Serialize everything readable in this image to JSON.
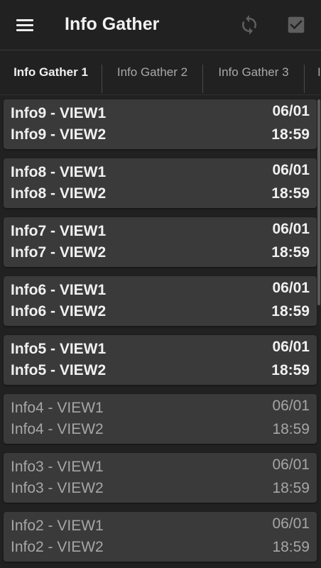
{
  "app": {
    "title": "Info Gather",
    "menu_icon": "hamburger-menu-icon",
    "actions": [
      {
        "name": "refresh",
        "icon": "refresh-icon"
      },
      {
        "name": "select-all",
        "icon": "checkbox-icon"
      }
    ]
  },
  "tabs": [
    {
      "label": "Info Gather 1",
      "active": true
    },
    {
      "label": "Info Gather 2",
      "active": false
    },
    {
      "label": "Info Gather 3",
      "active": false
    },
    {
      "label": "I",
      "active": false
    }
  ],
  "items": [
    {
      "line1": "Info9 - VIEW1",
      "line2": "Info9 - VIEW2",
      "date": "06/01",
      "time": "18:59",
      "unread": true
    },
    {
      "line1": "Info8 - VIEW1",
      "line2": "Info8 - VIEW2",
      "date": "06/01",
      "time": "18:59",
      "unread": true
    },
    {
      "line1": "Info7 - VIEW1",
      "line2": "Info7 - VIEW2",
      "date": "06/01",
      "time": "18:59",
      "unread": true
    },
    {
      "line1": "Info6 - VIEW1",
      "line2": "Info6 - VIEW2",
      "date": "06/01",
      "time": "18:59",
      "unread": true
    },
    {
      "line1": "Info5 - VIEW1",
      "line2": "Info5 - VIEW2",
      "date": "06/01",
      "time": "18:59",
      "unread": true
    },
    {
      "line1": "Info4 - VIEW1",
      "line2": "Info4 - VIEW2",
      "date": "06/01",
      "time": "18:59",
      "unread": false
    },
    {
      "line1": "Info3 - VIEW1",
      "line2": "Info3 - VIEW2",
      "date": "06/01",
      "time": "18:59",
      "unread": false
    },
    {
      "line1": "Info2 - VIEW1",
      "line2": "Info2 - VIEW2",
      "date": "06/01",
      "time": "18:59",
      "unread": false
    }
  ],
  "colors": {
    "background": "#212121",
    "card": "#3a3a3a",
    "accent": "#4a90d9"
  }
}
